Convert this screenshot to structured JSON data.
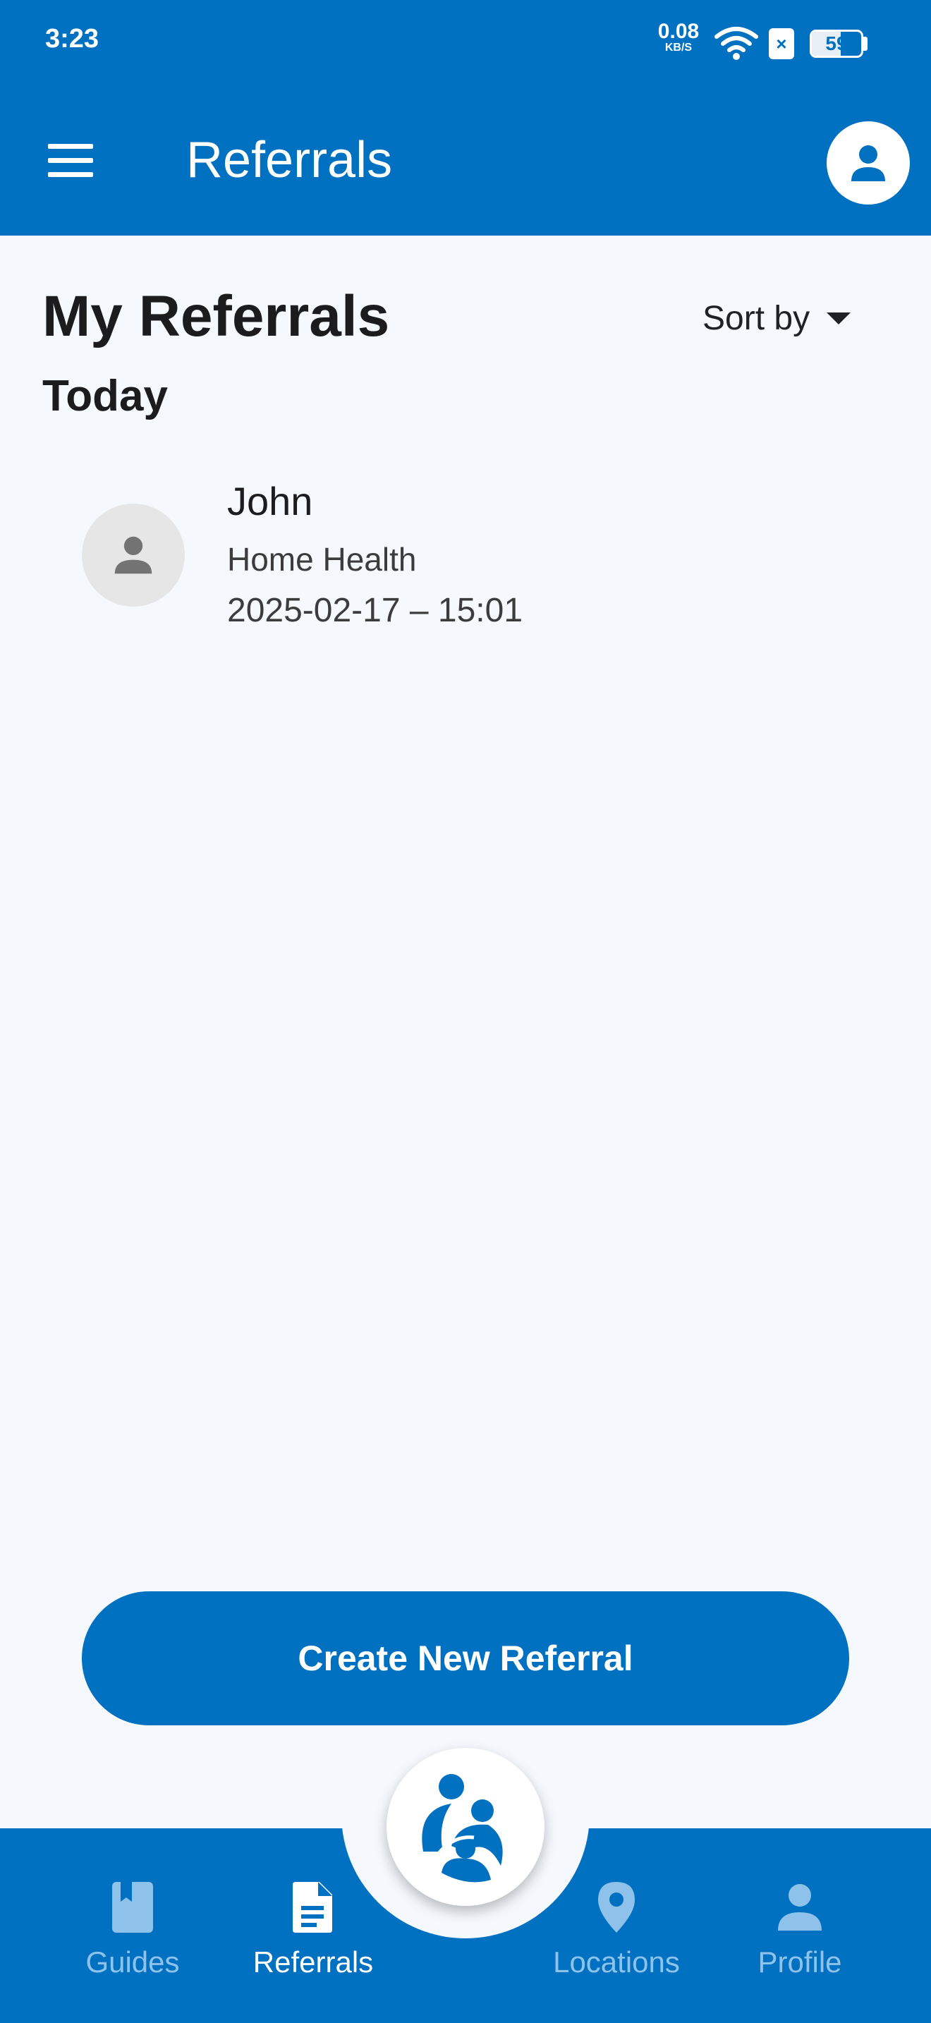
{
  "status_bar": {
    "time": "3:23",
    "network_speed": "0.08",
    "network_unit": "KB/S",
    "battery_level": "59",
    "battery_fraction": 0.59
  },
  "app_bar": {
    "title": "Referrals"
  },
  "page": {
    "title": "My Referrals",
    "sort_label": "Sort by",
    "section_today": "Today"
  },
  "referrals": [
    {
      "name": "John",
      "type": "Home Health",
      "datetime": "2025-02-17 – 15:01"
    }
  ],
  "actions": {
    "create_label": "Create New Referral"
  },
  "bottom_nav": {
    "guides": "Guides",
    "referrals": "Referrals",
    "locations": "Locations",
    "profile": "Profile"
  },
  "colors": {
    "primary": "#0071c1",
    "background": "#f5f8fd",
    "nav_inactive": "#8fc2ea"
  },
  "icons": {
    "menu": "hamburger-icon",
    "account": "account-icon",
    "sort": "triangle-down-icon",
    "guides": "book-icon",
    "referrals": "document-icon",
    "locations": "map-pin-icon",
    "profile": "person-icon",
    "logo": "family-logo-icon"
  }
}
